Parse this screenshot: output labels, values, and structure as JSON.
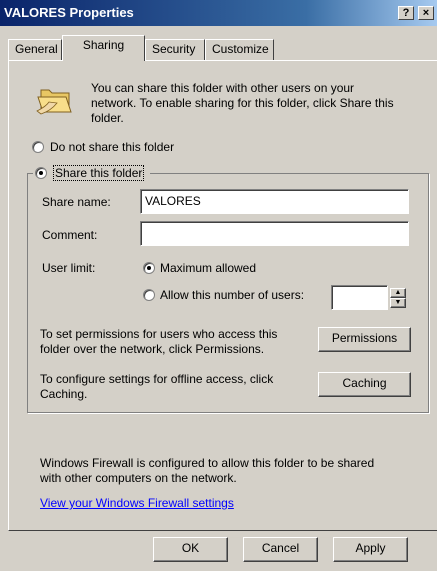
{
  "window": {
    "title": "VALORES Properties",
    "help_button": "?",
    "close_button": "×"
  },
  "tabs": [
    {
      "label": "General"
    },
    {
      "label": "Sharing"
    },
    {
      "label": "Security"
    },
    {
      "label": "Customize"
    }
  ],
  "sharing": {
    "intro_line1": "You can share this folder with other users on your",
    "intro_line2": "network.  To enable sharing for this folder, click Share this",
    "intro_line3": "folder.",
    "do_not_share_label": "Do not share this folder",
    "share_label": "Share this folder",
    "share_name_label": "Share name:",
    "share_name_value": "VALORES",
    "comment_label": "Comment:",
    "comment_value": "",
    "user_limit_label": "User limit:",
    "max_allowed_label": "Maximum allowed",
    "allow_number_label": "Allow this number of users:",
    "allow_number_value": "",
    "permissions_text_line1": "To set permissions for users who access this",
    "permissions_text_line2": "folder over the network, click Permissions.",
    "permissions_button": "Permissions",
    "caching_text_line1": "To configure settings for offline access, click",
    "caching_text_line2": "Caching.",
    "caching_button": "Caching",
    "firewall_text_line1": "Windows Firewall is configured to allow this folder to be shared",
    "firewall_text_line2": "with other computers on the network.",
    "firewall_link": "View your Windows Firewall settings"
  },
  "footer": {
    "ok": "OK",
    "cancel": "Cancel",
    "apply": "Apply"
  },
  "selected_tab": "Sharing",
  "selected_sharing_option": "Share this folder",
  "selected_user_limit": "Maximum allowed",
  "colors": {
    "titlebar_start": "#0a246a",
    "titlebar_end": "#a6caf0",
    "face": "#d4d0c8",
    "link": "#0000ff"
  }
}
